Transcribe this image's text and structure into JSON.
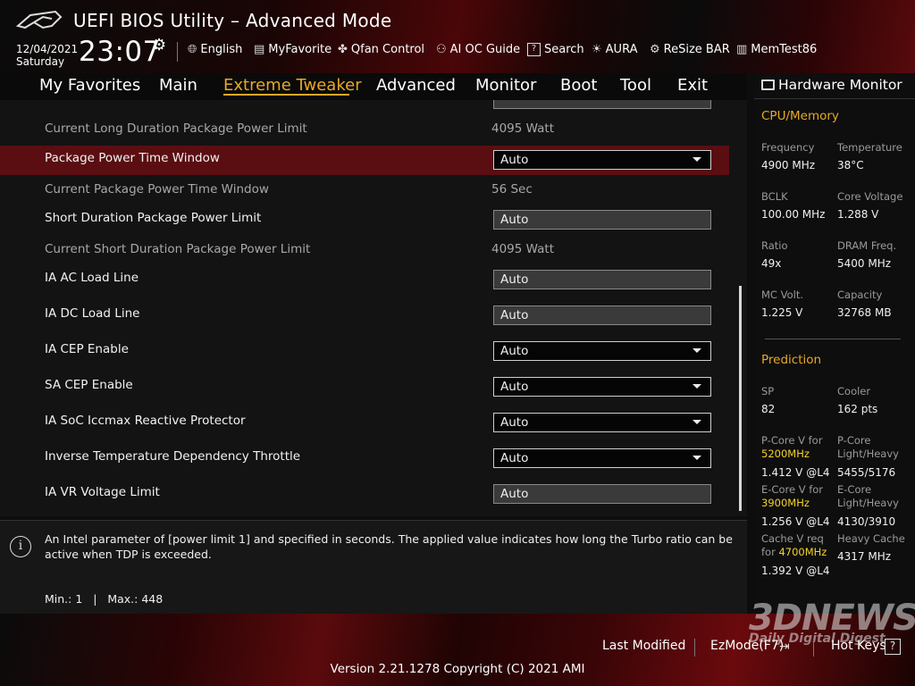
{
  "header": {
    "title": "UEFI BIOS Utility – Advanced Mode",
    "date": "12/04/2021",
    "day": "Saturday",
    "time": "23:07",
    "tools": [
      {
        "label": "English",
        "icon": "globe-icon"
      },
      {
        "label": "MyFavorite",
        "icon": "favorite-icon"
      },
      {
        "label": "Qfan Control",
        "icon": "fan-icon"
      },
      {
        "label": "AI OC Guide",
        "icon": "ai-guide-icon"
      },
      {
        "label": "Search",
        "icon": "search-icon"
      },
      {
        "label": "AURA",
        "icon": "aura-icon"
      },
      {
        "label": "ReSize BAR",
        "icon": "resize-bar-icon"
      },
      {
        "label": "MemTest86",
        "icon": "memtest-icon"
      }
    ]
  },
  "nav": {
    "tabs": [
      "My Favorites",
      "Main",
      "Extreme Tweaker",
      "Advanced",
      "Monitor",
      "Boot",
      "Tool",
      "Exit"
    ],
    "active": "Extreme Tweaker"
  },
  "settings": [
    {
      "label": "Current Long Duration Package Power Limit",
      "value": "4095 Watt"
    },
    {
      "label": "Package Power Time Window",
      "value": "Auto"
    },
    {
      "label": "Current Package Power Time Window",
      "value": "56 Sec"
    },
    {
      "label": "Short Duration Package Power Limit",
      "value": "Auto"
    },
    {
      "label": "Current Short Duration Package Power Limit",
      "value": "4095 Watt"
    },
    {
      "label": "IA AC Load Line",
      "value": "Auto"
    },
    {
      "label": "IA DC Load Line",
      "value": "Auto"
    },
    {
      "label": "IA CEP Enable",
      "value": "Auto"
    },
    {
      "label": "SA CEP Enable",
      "value": "Auto"
    },
    {
      "label": "IA SoC Iccmax Reactive Protector",
      "value": "Auto"
    },
    {
      "label": "Inverse Temperature Dependency Throttle",
      "value": "Auto"
    },
    {
      "label": "IA VR Voltage Limit",
      "value": "Auto"
    }
  ],
  "help": {
    "text": "An Intel parameter of [power limit 1] and specified in seconds. The applied value indicates how long the Turbo ratio can be active when TDP is exceeded.",
    "range": "Min.: 1   |   Max.: 448"
  },
  "hardware_monitor": {
    "title": "Hardware Monitor",
    "cpu_memory": {
      "heading": "CPU/Memory",
      "frequency_label": "Frequency",
      "frequency": "4900 MHz",
      "temperature_label": "Temperature",
      "temperature": "38°C",
      "bclk_label": "BCLK",
      "bclk": "100.00 MHz",
      "core_voltage_label": "Core Voltage",
      "core_voltage": "1.288 V",
      "ratio_label": "Ratio",
      "ratio": "49x",
      "dram_freq_label": "DRAM Freq.",
      "dram_freq": "5400 MHz",
      "mc_volt_label": "MC Volt.",
      "mc_volt": "1.225 V",
      "capacity_label": "Capacity",
      "capacity": "32768 MB"
    },
    "prediction": {
      "heading": "Prediction",
      "sp_label": "SP",
      "sp": "82",
      "cooler_label": "Cooler",
      "cooler": "162 pts",
      "pcore_v_label": "P-Core V for",
      "pcore_v_freq": "5200MHz",
      "pcore_v": "1.412 V @L4",
      "pcore_lh_label1": "P-Core",
      "pcore_lh_label2": "Light/Heavy",
      "pcore_lh": "5455/5176",
      "ecore_v_label": "E-Core V for",
      "ecore_v_freq": "3900MHz",
      "ecore_v": "1.256 V @L4",
      "ecore_lh_label1": "E-Core",
      "ecore_lh_label2": "Light/Heavy",
      "ecore_lh": "4130/3910",
      "cache_v_label1": "Cache V req",
      "cache_v_label2": "for",
      "cache_v_freq": "4700MHz",
      "cache_v": "1.392 V @L4",
      "heavy_cache_label": "Heavy Cache",
      "heavy_cache": "4317 MHz"
    }
  },
  "footer": {
    "last_modified": "Last Modified",
    "ezmode": "EzMode(F7)",
    "hot_keys": "Hot Keys",
    "hot_keys_icon": "?",
    "version": "Version 2.21.1278 Copyright (C) 2021 AMI",
    "watermark": "3DNEWS",
    "watermark_sub": "Daily Digital Digest"
  }
}
